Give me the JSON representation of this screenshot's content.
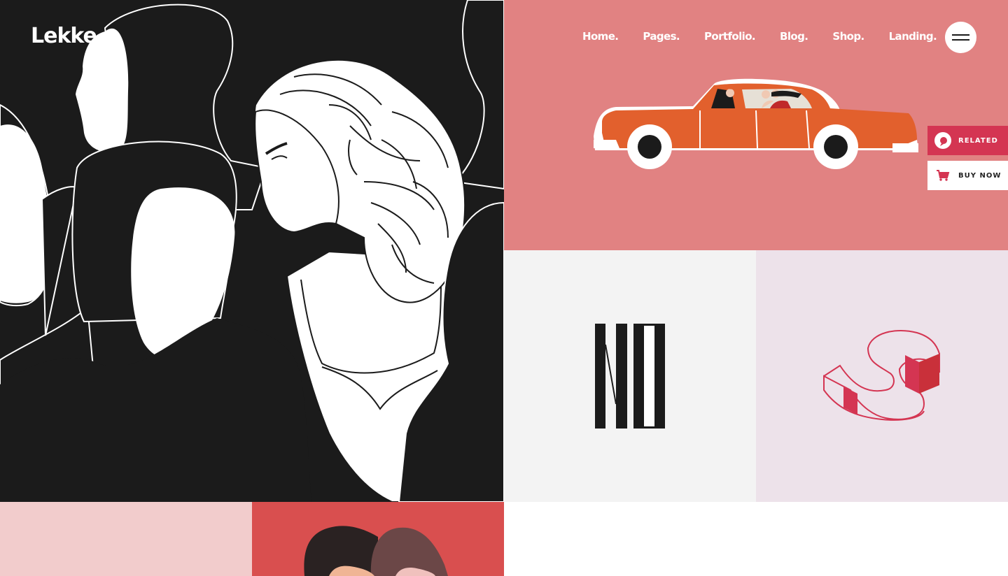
{
  "brand": {
    "logo_text": "Lekke"
  },
  "nav": {
    "items": [
      {
        "label": "Home."
      },
      {
        "label": "Pages."
      },
      {
        "label": "Portfolio."
      },
      {
        "label": "Blog."
      },
      {
        "label": "Shop."
      },
      {
        "label": "Landing."
      }
    ],
    "menu_icon": "hamburger-icon"
  },
  "side_actions": {
    "related": {
      "label": "RELATED",
      "icon": "related-icon"
    },
    "buy_now": {
      "label": "BUY NOW",
      "icon": "cart-icon"
    }
  },
  "colors": {
    "dark_tile": "#1b1b1b",
    "car_tile": "#e18282",
    "letters_tile": "#f3f3f3",
    "s_tile": "#ede2ea",
    "pink_tile": "#f2cccc",
    "red_tile": "#d94f4f",
    "accent_red": "#d43552",
    "car_orange": "#e2602d"
  },
  "portfolio": {
    "tiles": [
      {
        "name": "women-illustration"
      },
      {
        "name": "car-illustration"
      },
      {
        "name": "letters-no-illustration"
      },
      {
        "name": "3d-s-illustration"
      },
      {
        "name": "pink-tile"
      },
      {
        "name": "couple-illustration"
      }
    ]
  }
}
